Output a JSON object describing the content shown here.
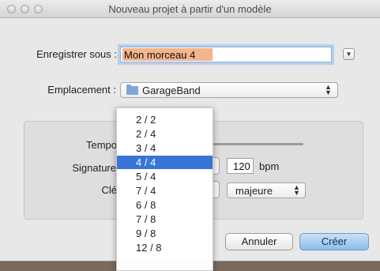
{
  "window": {
    "title": "Nouveau projet à partir d'un modèle"
  },
  "save_as": {
    "label": "Enregistrer sous :",
    "value": "Mon morceau 4"
  },
  "location": {
    "label": "Emplacement :",
    "value": "GarageBand",
    "icon": "folder-icon"
  },
  "settings": {
    "tempo_label": "Tempo",
    "signature_label": "Signature",
    "key_label": "Clé",
    "tempo_value": "120",
    "tempo_unit": "bpm",
    "mode_value": "majeure"
  },
  "signature_menu": {
    "items": [
      "2 / 2",
      "2 / 4",
      "3 / 4",
      "4 / 4",
      "5 / 4",
      "7 / 4",
      "6 / 8",
      "7 / 8",
      "9 / 8",
      "12 / 8"
    ],
    "selected": "4 / 4"
  },
  "buttons": {
    "cancel": "Annuler",
    "create": "Créer"
  },
  "colors": {
    "accent": "#3875d7",
    "selection_text_bg": "#f4b48c",
    "default_button": "#8dbdeb"
  }
}
